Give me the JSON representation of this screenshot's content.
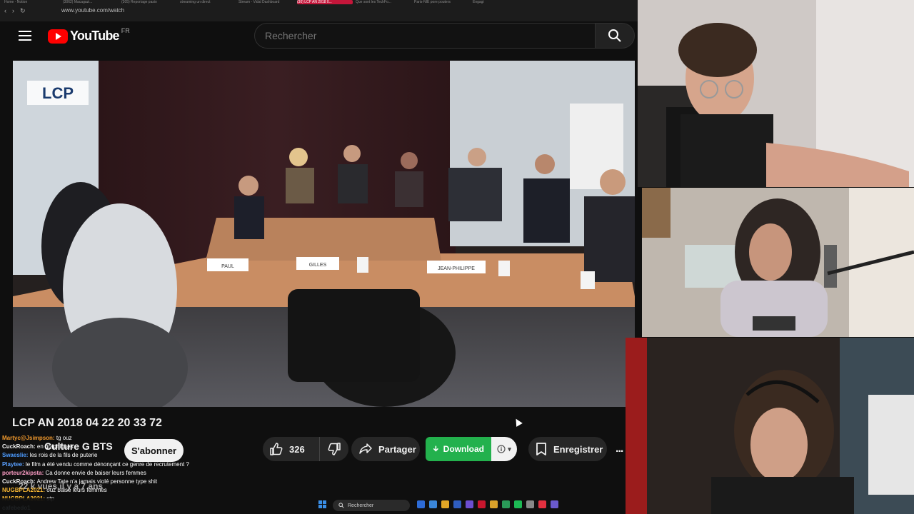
{
  "browser": {
    "url": "www.youtube.com/watch",
    "tabs": [
      "Home - Notion",
      "(3062) Macagazi...",
      "(305) Reportage pasio",
      "streaming un direct",
      "Stream - Vidal Dashboard",
      "(30) LCP AN 2018 0...",
      "Que sont les TechFo...",
      "Paris-NIE pore pouters",
      "Engagi"
    ]
  },
  "header": {
    "logo_text": "YouTube",
    "country_code": "FR",
    "search_placeholder": "Rechercher"
  },
  "video": {
    "title": "LCP AN 2018 04 22 20 33 72",
    "channel_logo_text": "LCP",
    "name_cards": [
      "PAUL",
      "GILLES",
      "JEAN-PHILIPPE"
    ]
  },
  "channel": {
    "name": "Culture G BTS",
    "subscribe_label": "S'abonner",
    "views_text": "22 k vues  il y a 7 ans"
  },
  "actions": {
    "like_count": "326",
    "share_label": "Partager",
    "download_label": "Download",
    "save_label": "Enregistrer",
    "more_label": "..."
  },
  "chat": [
    {
      "user": "Martyc@Jsimpson:",
      "text": "tg ouz",
      "color": "#f29a2e"
    },
    {
      "user": "CuckRoach:",
      "text": "en graphiques",
      "color": "#f2f2f2"
    },
    {
      "user": "Swaeslie:",
      "text": "les rois de la fils de puterie",
      "color": "#4c9bff"
    },
    {
      "user": "Playtee:",
      "text": "le film a été vendu comme dénonçant ce genre de recrutement ?",
      "color": "#5aa0ff"
    },
    {
      "user": "porteur2kipsta:",
      "text": "Ca donne envie de baiser leurs femmes",
      "color": "#ff9ec7"
    },
    {
      "user": "CuckRoach:",
      "text": "Andrew Tate n'a jamais violé personne type shit",
      "color": "#f2f2f2"
    },
    {
      "user": "NUGBPLA2021:",
      "text": "ouz baise leurs femmes",
      "color": "#f7b733"
    },
    {
      "user": "NUGBPLA2021:",
      "text": "stp",
      "color": "#f7b733"
    },
    {
      "user": "cafebedo1",
      "text": "",
      "color": "#bfe3ff"
    }
  ],
  "taskbar": {
    "search_label": "Rechercher",
    "icon_colors": [
      "#2d6bd6",
      "#3a86d9",
      "#e0a526",
      "#2f5dbf",
      "#6c4ed1",
      "#c8162e",
      "#d9a12a",
      "#2a9a58",
      "#1db954",
      "#888888",
      "#e3303f",
      "#6a5acd"
    ]
  }
}
